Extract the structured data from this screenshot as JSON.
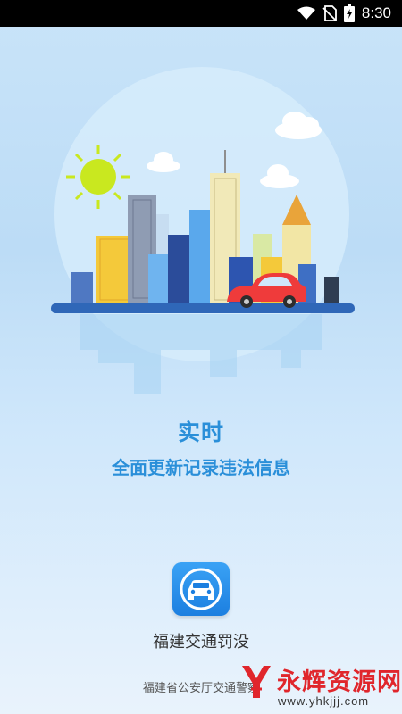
{
  "status_bar": {
    "time": "8:30",
    "icons": [
      "wifi-icon",
      "no-sim-icon",
      "battery-charging-icon"
    ]
  },
  "splash": {
    "title": "实时",
    "subtitle": "全面更新记录违法信息"
  },
  "app": {
    "name": "福建交通罚没",
    "icon": "car-app-icon",
    "publisher": "福建省公安厅交通警察"
  },
  "watermark": {
    "text": "永辉资源网",
    "url": "www.yhkjjj.com"
  },
  "colors": {
    "accent": "#2a8fd9",
    "icon_bg": "#1c7fe0",
    "car": "#ef3b3b",
    "sun": "#c9e81f",
    "watermark": "#e0262c"
  }
}
